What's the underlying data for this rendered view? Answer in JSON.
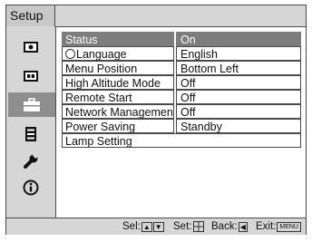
{
  "menu": {
    "title": "Setup",
    "sidebar": [
      {
        "icon": "picture-icon"
      },
      {
        "icon": "input-icon"
      },
      {
        "icon": "setup-toolbox-icon",
        "selected": true
      },
      {
        "icon": "menu-list-icon"
      },
      {
        "icon": "wrench-icon"
      },
      {
        "icon": "info-icon"
      }
    ],
    "items": [
      {
        "label": "Status",
        "value": "On",
        "selected": true
      },
      {
        "label": "Language",
        "value": "English",
        "icon": "language-icon"
      },
      {
        "label": "Menu Position",
        "value": "Bottom Left"
      },
      {
        "label": "High Altitude Mode",
        "value": "Off"
      },
      {
        "label": "Remote Start",
        "value": "Off"
      },
      {
        "label": "Network Management",
        "value": "Off"
      },
      {
        "label": "Power Saving",
        "value": "Standby"
      },
      {
        "label": "Lamp Setting"
      }
    ]
  },
  "footer": {
    "sel_label": "Sel:",
    "set_label": "Set:",
    "back_label": "Back:",
    "exit_label": "Exit:",
    "menu_key": "MENU"
  },
  "colors": {
    "selected_row": "#7d7d7d",
    "selected_sidebar": "#8e8e8e",
    "panel": "#d6d6d6",
    "border": "#4a4a4a"
  }
}
